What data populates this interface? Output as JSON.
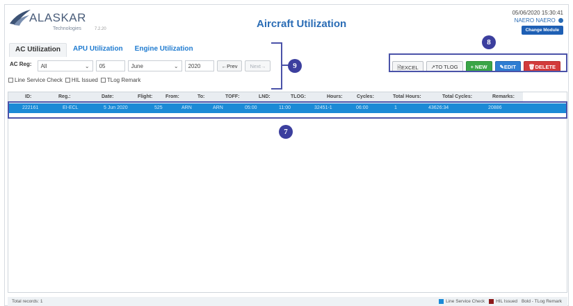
{
  "header": {
    "logo_text": "ALASKAR",
    "logo_sub": "Technologies",
    "version": "7.2.20",
    "title": "Aircraft Utilization",
    "datetime": "05/06/2020 15:30:41",
    "user": "NAERO NAERO",
    "change_module": "Change Module"
  },
  "tabs": [
    {
      "label": "AC Utilization",
      "active": true
    },
    {
      "label": "APU Utilization",
      "active": false
    },
    {
      "label": "Engine Utilization",
      "active": false
    }
  ],
  "filters": {
    "ac_reg_label": "AC Reg:",
    "ac_reg_value": "All",
    "day": "05",
    "month": "June",
    "year": "2020",
    "prev_label": "←Prev",
    "next_label": "Next→"
  },
  "checks": {
    "line_service": "Line Service Check",
    "hil": "HIL Issued",
    "tlog_remark": "TLog Remark"
  },
  "actions": {
    "excel": "EXCEL",
    "to_tlog": "↗TO TLOG",
    "new": "+ NEW",
    "edit": "EDIT",
    "delete": "DELETE"
  },
  "callouts": {
    "c7": "7",
    "c8": "8",
    "c9": "9"
  },
  "table": {
    "headers": [
      "ID:",
      "Reg.:",
      "Date:",
      "Flight:",
      "From:",
      "To:",
      "TOFF:",
      "LND:",
      "TLOG:",
      "Hours:",
      "Cycles:",
      "Total Hours:",
      "Total Cycles:",
      "Remarks:"
    ],
    "rows": [
      [
        "222161",
        "EI-ECL",
        "5 Jun 2020",
        "525",
        "ARN",
        "ARN",
        "05:00",
        "11:00",
        "32451-1",
        "06:00",
        "1",
        "43626:34",
        "20886",
        ""
      ]
    ]
  },
  "footer": {
    "records": "Total records: 1",
    "legend_line_service": "Line Service Check",
    "legend_hil": "HIL Issued",
    "legend_bold": "Bold - TLog Remark"
  },
  "colors": {
    "accent": "#1f7bd0",
    "selected_row": "#1b8ad6",
    "callout": "#3c3f9e",
    "new": "#3aa547",
    "edit": "#2e7dd2",
    "delete": "#d23b3b"
  }
}
